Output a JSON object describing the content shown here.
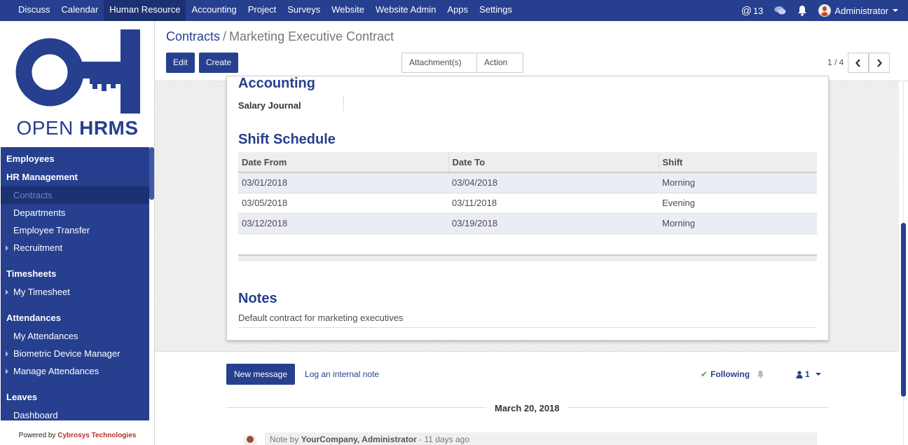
{
  "topbar": {
    "menu": [
      "Discuss",
      "Calendar",
      "Human Resource",
      "Accounting",
      "Project",
      "Surveys",
      "Website",
      "Website Admin",
      "Apps",
      "Settings"
    ],
    "active": "Human Resource",
    "mention_count": "13",
    "user": "Administrator"
  },
  "brand": {
    "open": "OPEN",
    "hrms": "HRMS",
    "color": "#263f8f"
  },
  "sidebar": {
    "sections": [
      {
        "title": "Employees",
        "items": []
      },
      {
        "title": "HR Management",
        "items": [
          "Contracts",
          "Departments",
          "Employee Transfer",
          "Recruitment"
        ]
      },
      {
        "title": "Timesheets",
        "items": [
          "My Timesheet"
        ]
      },
      {
        "title": "Attendances",
        "items": [
          "My Attendances",
          "Biometric Device Manager",
          "Manage Attendances"
        ]
      },
      {
        "title": "Leaves",
        "items": [
          "Dashboard"
        ]
      }
    ],
    "active_item": "Contracts",
    "powered_by": "Powered by",
    "company": "Cybrosys Technologies"
  },
  "breadcrumb": {
    "parent": "Contracts",
    "separator": "/",
    "current": "Marketing Executive Contract"
  },
  "buttons": {
    "edit": "Edit",
    "create": "Create",
    "attachments": "Attachment(s)",
    "action": "Action"
  },
  "pager": {
    "value": "1 / 4"
  },
  "form": {
    "accounting_title": "Accounting",
    "salary_journal_label": "Salary Journal",
    "salary_journal_value": "",
    "shift_title": "Shift Schedule",
    "shift_columns": [
      "Date From",
      "Date To",
      "Shift"
    ],
    "shift_rows": [
      [
        "03/01/2018",
        "03/04/2018",
        "Morning"
      ],
      [
        "03/05/2018",
        "03/11/2018",
        "Evening"
      ],
      [
        "03/12/2018",
        "03/19/2018",
        "Morning"
      ]
    ],
    "notes_title": "Notes",
    "notes_text": "Default contract for marketing executives"
  },
  "chatter": {
    "new_message": "New message",
    "log_note": "Log an internal note",
    "following": "Following",
    "followers": "1",
    "date": "March 20, 2018",
    "message_prefix": "Note by",
    "message_author": "YourCompany, Administrator",
    "message_time": "- 11 days ago"
  },
  "colors": {
    "brand": "#263f8f",
    "active_menu": "#1c3172",
    "following_check": "#4aa34a"
  }
}
